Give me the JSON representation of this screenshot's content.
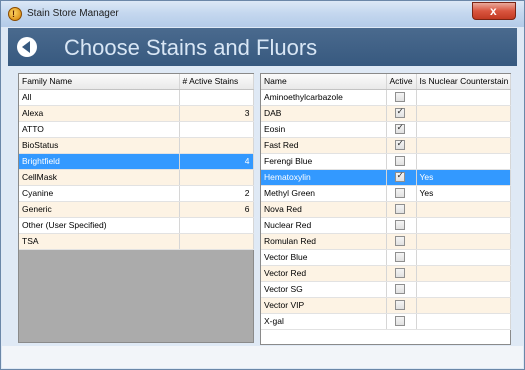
{
  "window": {
    "title": "Stain Store Manager",
    "close_glyph": "x"
  },
  "header": {
    "title": "Choose Stains and Fluors"
  },
  "families": {
    "columns": [
      "Family Name",
      "# Active Stains"
    ],
    "rows": [
      {
        "name": "All",
        "count": ""
      },
      {
        "name": "Alexa",
        "count": "3"
      },
      {
        "name": "ATTO",
        "count": ""
      },
      {
        "name": "BioStatus",
        "count": ""
      },
      {
        "name": "Brightfield",
        "count": "4",
        "selected": true
      },
      {
        "name": "CellMask",
        "count": ""
      },
      {
        "name": "Cyanine",
        "count": "2"
      },
      {
        "name": "Generic",
        "count": "6"
      },
      {
        "name": "Other (User Specified)",
        "count": ""
      },
      {
        "name": "TSA",
        "count": ""
      }
    ]
  },
  "stains": {
    "columns": [
      "Name",
      "Active",
      "Is Nuclear Counterstain"
    ],
    "rows": [
      {
        "name": "Aminoethylcarbazole",
        "active": false,
        "nuclear": ""
      },
      {
        "name": "DAB",
        "active": true,
        "nuclear": ""
      },
      {
        "name": "Eosin",
        "active": true,
        "nuclear": ""
      },
      {
        "name": "Fast Red",
        "active": true,
        "nuclear": ""
      },
      {
        "name": "Ferengi Blue",
        "active": false,
        "nuclear": ""
      },
      {
        "name": "Hematoxylin",
        "active": true,
        "nuclear": "Yes",
        "selected": true
      },
      {
        "name": "Methyl Green",
        "active": false,
        "nuclear": "Yes"
      },
      {
        "name": "Nova Red",
        "active": false,
        "nuclear": ""
      },
      {
        "name": "Nuclear Red",
        "active": false,
        "nuclear": ""
      },
      {
        "name": "Romulan Red",
        "active": false,
        "nuclear": ""
      },
      {
        "name": "Vector Blue",
        "active": false,
        "nuclear": ""
      },
      {
        "name": "Vector Red",
        "active": false,
        "nuclear": ""
      },
      {
        "name": "Vector SG",
        "active": false,
        "nuclear": ""
      },
      {
        "name": "Vector VIP",
        "active": false,
        "nuclear": ""
      },
      {
        "name": "X-gal",
        "active": false,
        "nuclear": ""
      }
    ]
  },
  "colors": {
    "accent": "#3399ff",
    "header_bg": "#37597f",
    "alt_row": "#fdf3e4"
  }
}
